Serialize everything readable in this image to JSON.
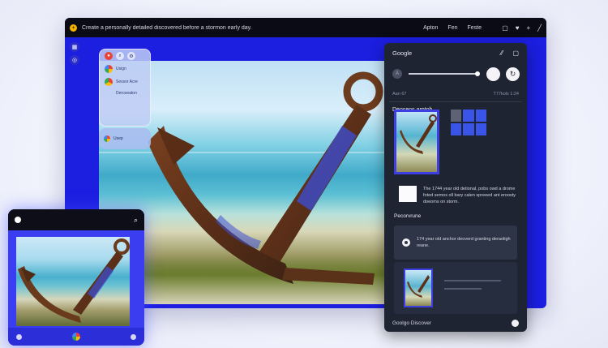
{
  "window": {
    "title": "Create a personally detailed discovered before a stormon early day.",
    "menu": [
      "Apton",
      "Fen",
      "Feste"
    ],
    "icons": [
      "square-icon",
      "heart-icon",
      "plus-icon",
      "pen-icon"
    ]
  },
  "glass_panel": {
    "items": [
      {
        "icon": "google-g-icon",
        "label": "Usign"
      },
      {
        "icon": "chrome-icon",
        "label": "Sessor Acre"
      },
      {
        "icon": "",
        "label": "Deroseaton"
      }
    ],
    "pill_label": "Usep"
  },
  "side_panel": {
    "header_title": "Google",
    "meta_left": "Aan 67",
    "meta_right": "T77kols 1:24",
    "section_title": "Deoseos arptoh",
    "description": "The 1744 year old detional, pobs owd a drome foted semos oll bary calen spreeed ant eroosty doeoms on storm.",
    "related_label": "Pecorvrune",
    "card_text": "174 year old anchor deoverd granting deraoligh reane.",
    "footer_label": "Goolgo Discover",
    "grid_colors": [
      "#5d6374",
      "#3b54e8",
      "#3b54e8",
      "#3b54e8",
      "#3b54e8",
      "#3b54e8"
    ]
  },
  "colors": {
    "window_bg": "#1c1ee0",
    "titlebar": "#0a0b14",
    "side_panel": "#1e2432",
    "accent_blue": "#3d3fe2",
    "anchor_rust": "#6b3a1f"
  }
}
